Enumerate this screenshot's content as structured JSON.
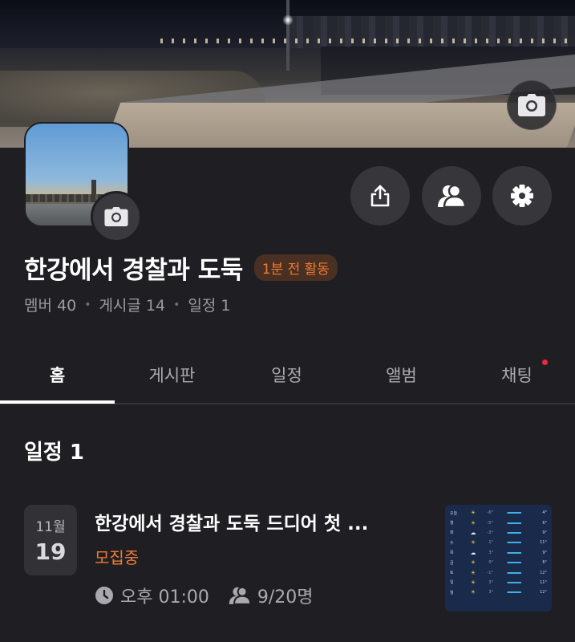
{
  "group": {
    "name": "한강에서 경찰과 도둑",
    "activity": "1분 전 활동",
    "members": "멤버 40",
    "posts": "게시글 14",
    "schedules": "일정 1",
    "separator": "•"
  },
  "tabs": [
    {
      "label": "홈",
      "active": true
    },
    {
      "label": "게시판"
    },
    {
      "label": "일정"
    },
    {
      "label": "앨범"
    },
    {
      "label": "채팅",
      "has_new": true
    }
  ],
  "schedule_section": {
    "title": "일정 1",
    "event": {
      "month": "11월",
      "day": "19",
      "title": "한강에서 경찰과 도둑 드디어 첫 ...",
      "status": "모집중",
      "time": "오후 01:00",
      "participants": "9/20명"
    }
  },
  "weather_thumbnail": {
    "rows": [
      {
        "day": "오늘",
        "icon": "☀",
        "low": "-6°",
        "high": "4°"
      },
      {
        "day": "월",
        "icon": "☀",
        "low": "-5°",
        "high": "6°"
      },
      {
        "day": "화",
        "icon": "☁",
        "low": "-3°",
        "high": "9°"
      },
      {
        "day": "수",
        "icon": "☀",
        "low": "1°",
        "high": "11°"
      },
      {
        "day": "목",
        "icon": "☁",
        "low": "3°",
        "high": "9°"
      },
      {
        "day": "금",
        "icon": "☀",
        "low": "0°",
        "high": "6°"
      },
      {
        "day": "토",
        "icon": "☀",
        "low": "-1°",
        "high": "12°"
      },
      {
        "day": "일",
        "icon": "☀",
        "low": "3°",
        "high": "11°"
      },
      {
        "day": "월",
        "icon": "☀",
        "low": "3°",
        "high": "12°"
      }
    ]
  },
  "colors": {
    "background": "#1f1f23",
    "accent_orange": "#f07a34",
    "badge_bg": "#4a3022",
    "notification_dot": "#f0243a"
  },
  "icons": {
    "cover_camera": "camera-icon",
    "avatar_camera": "camera-icon",
    "share": "share-icon",
    "members": "members-icon",
    "settings": "gear-icon",
    "time": "clock-icon",
    "participants": "people-icon"
  }
}
